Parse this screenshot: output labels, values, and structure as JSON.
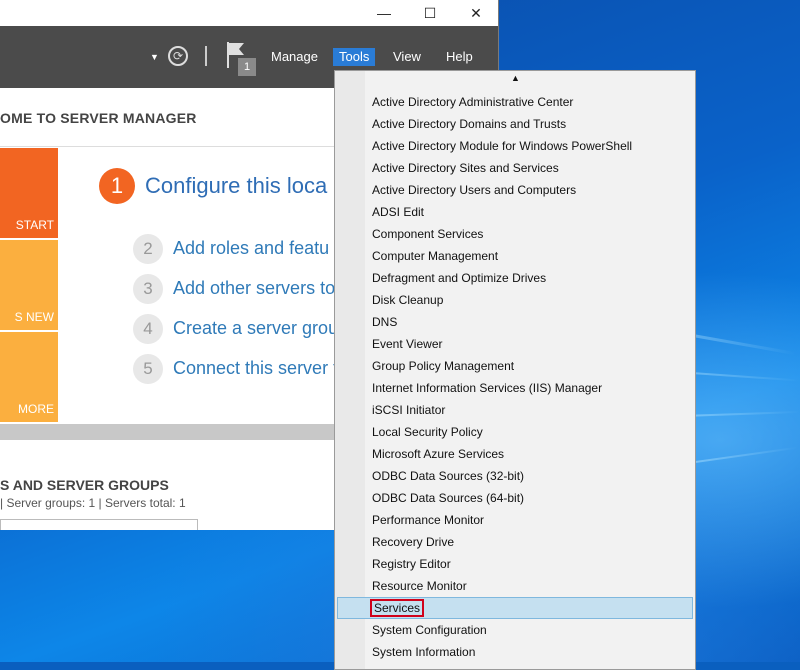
{
  "window": {
    "titlebar": {
      "minimize": "—",
      "maximize": "☐",
      "close": "✕"
    },
    "menubar": {
      "notification_count": "1",
      "items": [
        "Manage",
        "Tools",
        "View",
        "Help"
      ]
    },
    "welcome": {
      "title": "OME TO SERVER MANAGER",
      "tiles": [
        "START",
        "S NEW",
        "MORE"
      ],
      "step1": {
        "number": "1",
        "text": "Configure this loca"
      },
      "steps": [
        {
          "number": "2",
          "text": "Add roles and featu"
        },
        {
          "number": "3",
          "text": "Add other servers to"
        },
        {
          "number": "4",
          "text": "Create a server grou"
        },
        {
          "number": "5",
          "text": "Connect this server t"
        }
      ]
    },
    "roles": {
      "title": "S AND SERVER GROUPS",
      "subtitle": "  |  Server groups: 1   |  Servers total: 1"
    }
  },
  "tools_menu": {
    "scroll_up": "▲",
    "highlighted_index": 23,
    "items": [
      "Active Directory Administrative Center",
      "Active Directory Domains and Trusts",
      "Active Directory Module for Windows PowerShell",
      "Active Directory Sites and Services",
      "Active Directory Users and Computers",
      "ADSI Edit",
      "Component Services",
      "Computer Management",
      "Defragment and Optimize Drives",
      "Disk Cleanup",
      "DNS",
      "Event Viewer",
      "Group Policy Management",
      "Internet Information Services (IIS) Manager",
      "iSCSI Initiator",
      "Local Security Policy",
      "Microsoft Azure Services",
      "ODBC Data Sources (32-bit)",
      "ODBC Data Sources (64-bit)",
      "Performance Monitor",
      "Recovery Drive",
      "Registry Editor",
      "Resource Monitor",
      "Services",
      "System Configuration",
      "System Information"
    ]
  },
  "colors": {
    "accent": "#2a7cd6",
    "tile_orange": "#f26522",
    "tile_amber": "#fbaf3f",
    "highlight_outline": "#d0021b"
  }
}
